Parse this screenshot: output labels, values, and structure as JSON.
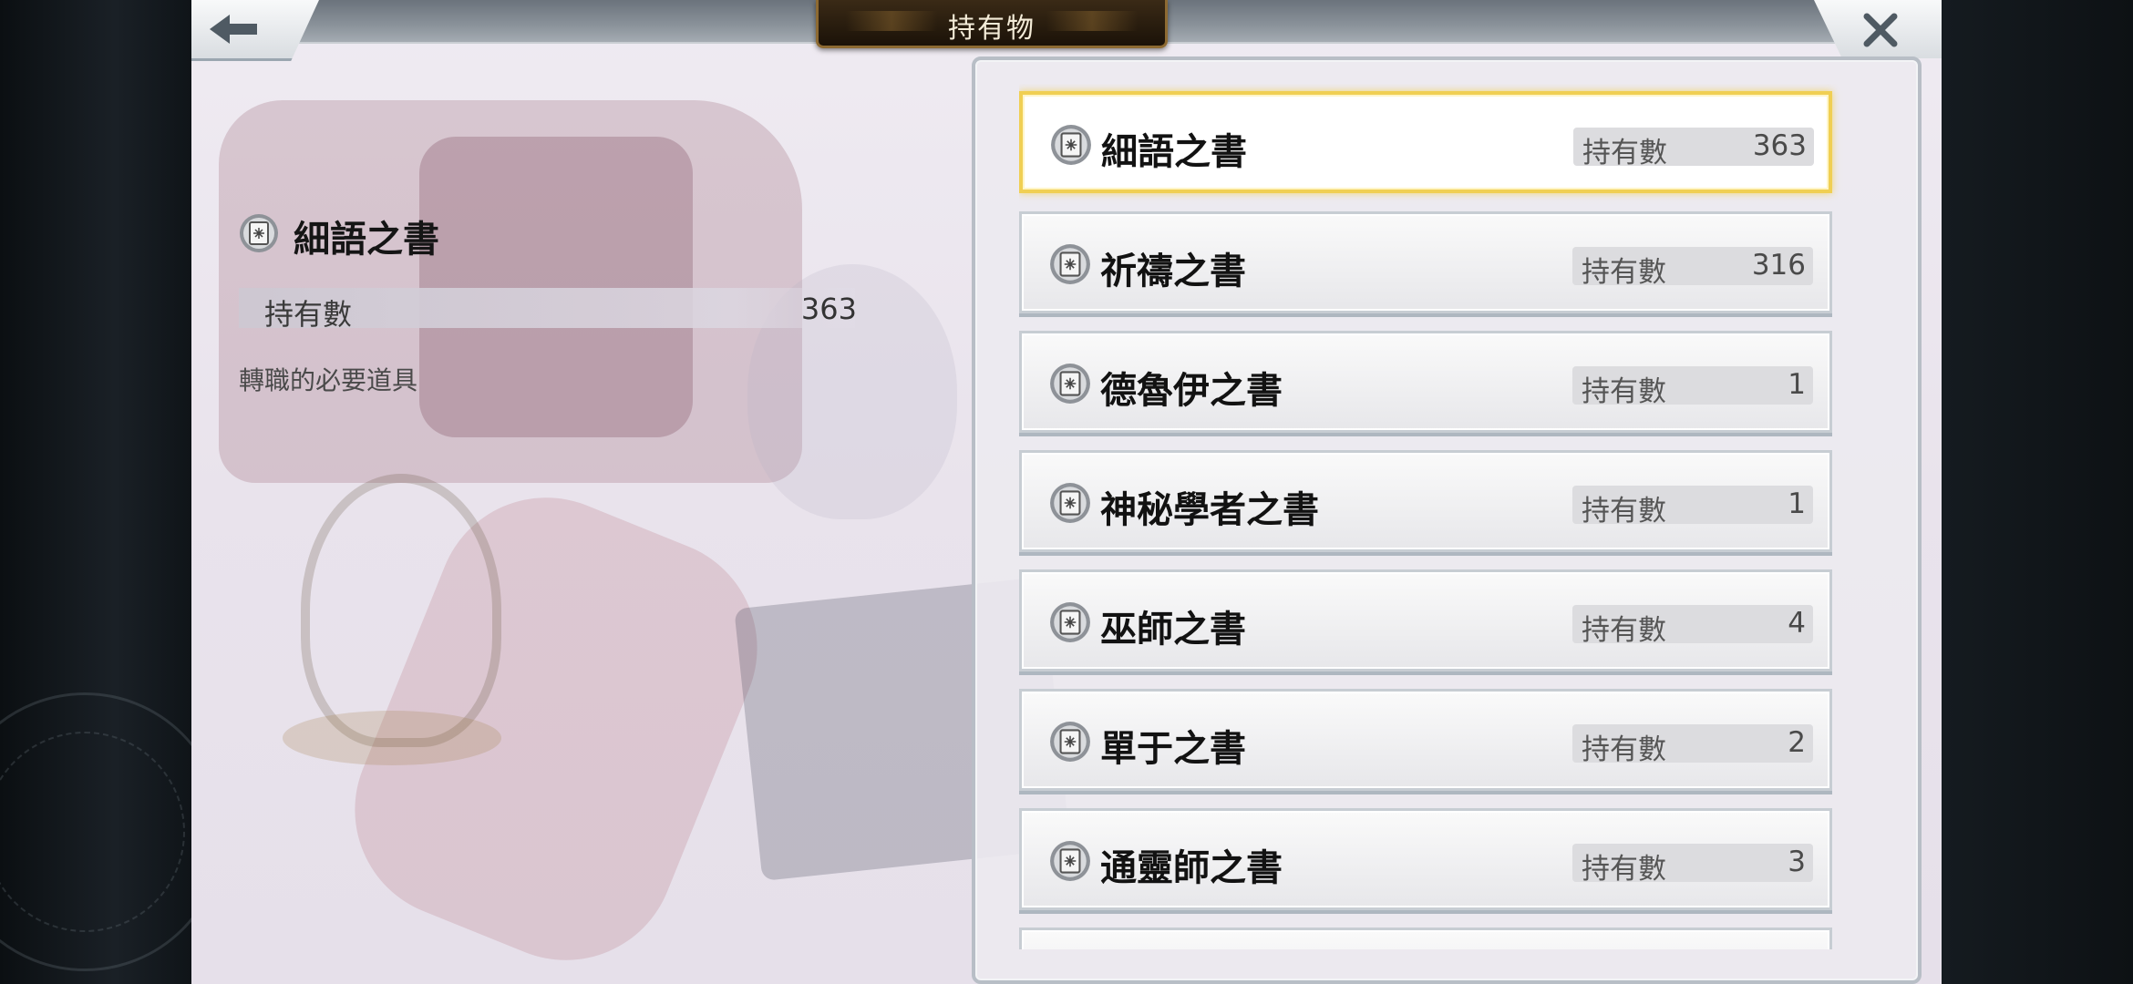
{
  "header": {
    "title": "持有物"
  },
  "controls": {
    "back_icon": "arrow-left-icon",
    "close_icon": "close-icon"
  },
  "detail": {
    "icon": "book-icon",
    "name": "細語之書",
    "count_label": "持有數",
    "count_value": "363",
    "description": "轉職的必要道具"
  },
  "list": {
    "items": [
      {
        "name": "細語之書",
        "count_label": "持有數",
        "count": "363",
        "selected": true
      },
      {
        "name": "祈禱之書",
        "count_label": "持有數",
        "count": "316"
      },
      {
        "name": "德魯伊之書",
        "count_label": "持有數",
        "count": "1"
      },
      {
        "name": "神秘學者之書",
        "count_label": "持有數",
        "count": "1"
      },
      {
        "name": "巫師之書",
        "count_label": "持有數",
        "count": "4"
      },
      {
        "name": "單于之書",
        "count_label": "持有數",
        "count": "2"
      },
      {
        "name": "通靈師之書",
        "count_label": "持有數",
        "count": "3"
      }
    ]
  },
  "colors": {
    "selected_border": "#f0cf53",
    "title_plate": "#2a1d0e"
  }
}
